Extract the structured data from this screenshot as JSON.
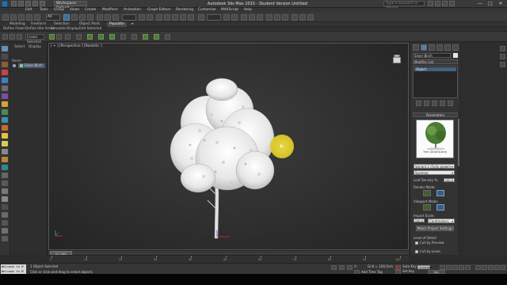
{
  "titlebar": {
    "workspace": "Workspace: Default",
    "title": "Autodesk 3ds Max  2015  - Student Version    Untitled",
    "search_placeholder": "Type a keyword or phrase",
    "win_min": "—",
    "win_max": "□",
    "win_close": "✕"
  },
  "menu": [
    "Edit",
    "Tools",
    "Group",
    "Views",
    "Create",
    "Modifiers",
    "Animation",
    "Graph Editors",
    "Rendering",
    "Customize",
    "MAXScript",
    "Help"
  ],
  "ribbon": {
    "tabs": [
      "Modeling",
      "Freeform",
      "Selection",
      "Object Paint",
      "Populate"
    ],
    "active_tab": "Populate",
    "row": [
      "Define Flows",
      "Define Idle Areas",
      "Simulate",
      "Display",
      "Edit Selected"
    ]
  },
  "toolbar": {
    "selection_filter": "All",
    "selection_set": "Create Selection Se"
  },
  "explorer": {
    "tabs": [
      "Select",
      "Display"
    ],
    "header": "Name",
    "items": [
      "Silver Birch"
    ]
  },
  "viewport": {
    "label": "[ + ] [Perspective ] [Realistic ]"
  },
  "command_panel": {
    "object_name": "Silver Birch",
    "modifier_list": "Modifier List",
    "stack_item": "Object",
    "rollout": "Parameters",
    "preview_caption": "Tree (Downsized)",
    "variant": "Variant 1 (Fully grown)",
    "season": "Summer",
    "leaf_density_label": "Leaf Density %:",
    "leaf_density_value": "100.0",
    "render_mode_label": "Render Mode:",
    "viewport_mode_label": "Viewport Mode:",
    "import_scale_label": "Import Scale:",
    "import_scale_value": "100.0",
    "import_units": "Centimeters",
    "match_button": "Match Project Settings",
    "lod_label": "Level of Detail",
    "cull_preview": "Cull by Preview",
    "cull_level": "Cull by Level"
  },
  "timeline": {
    "slider": "0 / 100",
    "ticks": [
      "0",
      "10",
      "20",
      "30",
      "40",
      "50",
      "60",
      "70",
      "80",
      "90",
      "100"
    ]
  },
  "status": {
    "maxscript_lines": [
      "Welcome to M",
      "Welcome to M"
    ],
    "selected": "1 Object Selected",
    "prompt": "Click or click-and-drag to select objects",
    "x_label": "X:",
    "y_label": "Y:",
    "z_label": "Z:",
    "grid": "Grid = 100,0cm",
    "add_time_tag": "Add Time Tag",
    "auto_key": "Auto Key",
    "set_key": "Set Key",
    "selected_dd": "Selected",
    "key_filters": "Key Filters..."
  },
  "colors": {
    "accent": "#e8d33a",
    "selection": "#43617d"
  }
}
